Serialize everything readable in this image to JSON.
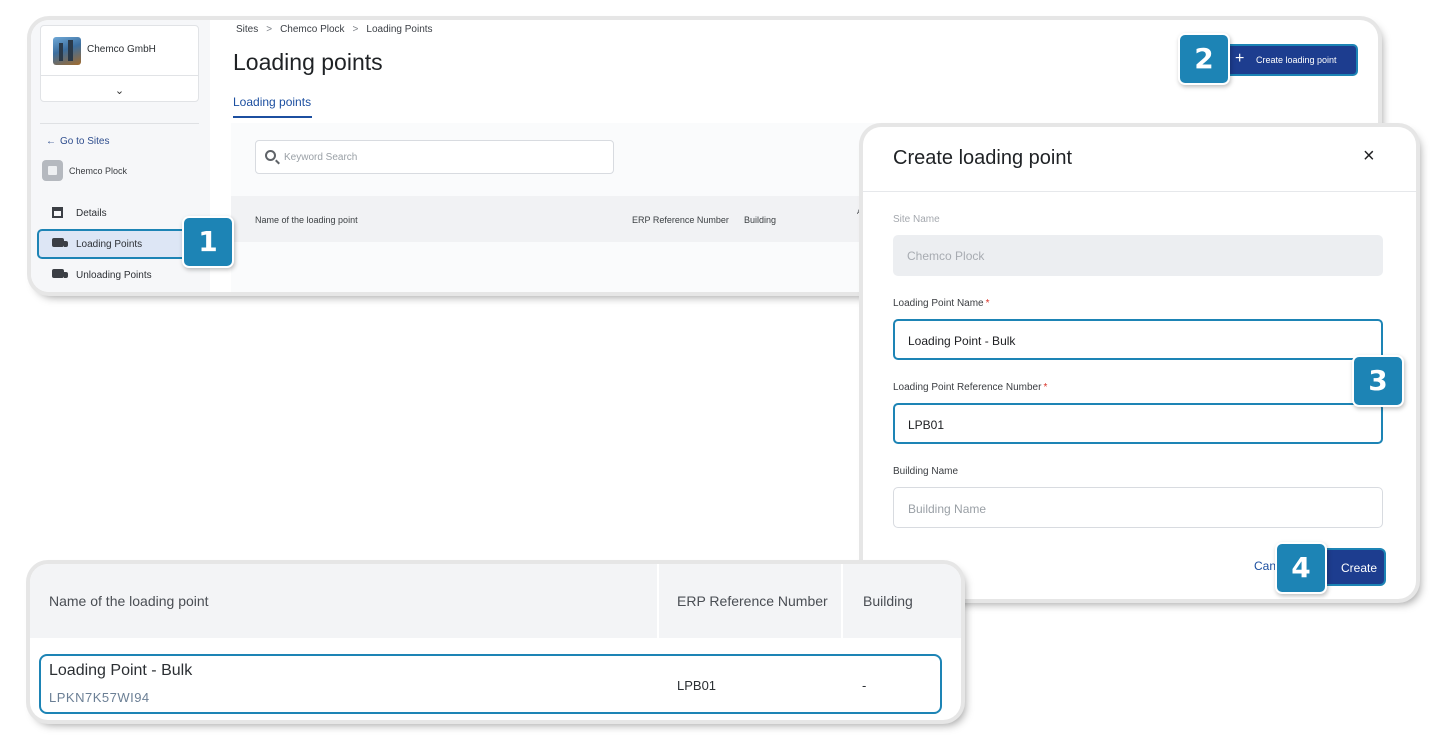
{
  "app": {
    "org_name": "Chemco GmbH",
    "goto_sites": "Go to Sites",
    "site_name": "Chemco Plock",
    "nav": [
      {
        "label": "Details",
        "icon": "building-icon"
      },
      {
        "label": "Loading Points",
        "icon": "truck-icon"
      },
      {
        "label": "Unloading Points",
        "icon": "truck-icon"
      }
    ],
    "breadcrumb": [
      "Sites",
      "Chemco Plock",
      "Loading Points"
    ],
    "breadcrumb_separator": ">",
    "title": "Loading points",
    "tab": "Loading points",
    "create_button": "Create loading point",
    "search_placeholder": "Keyword Search",
    "table_headers": [
      "Name of the loading point",
      "ERP Reference Number",
      "Building",
      "A"
    ]
  },
  "dialog": {
    "title": "Create loading point",
    "close_glyph": "×",
    "fields": [
      {
        "label": "Site Name",
        "value": "Chemco Plock",
        "required": false,
        "state": "disabled"
      },
      {
        "label": "Loading Point Name",
        "value": "Loading Point - Bulk",
        "required": true,
        "state": "filled"
      },
      {
        "label": "Loading Point Reference Number",
        "value": "LPB01",
        "required": true,
        "state": "filled"
      },
      {
        "label": "Building Name",
        "placeholder": "Building Name",
        "required": false,
        "state": "empty"
      }
    ],
    "required_marker": "*",
    "cancel": "Can",
    "create": "Create"
  },
  "result": {
    "headers": [
      "Name of the loading point",
      "ERP Reference Number",
      "Building"
    ],
    "row": {
      "name": "Loading Point - Bulk",
      "id": "LPKN7K57WI94",
      "erp": "LPB01",
      "building": "-"
    }
  },
  "steps": [
    "1",
    "2",
    "3",
    "4"
  ],
  "colors": {
    "highlight": "#1d84b5",
    "primary": "#1d3d8f",
    "link": "#1c4fa0"
  }
}
